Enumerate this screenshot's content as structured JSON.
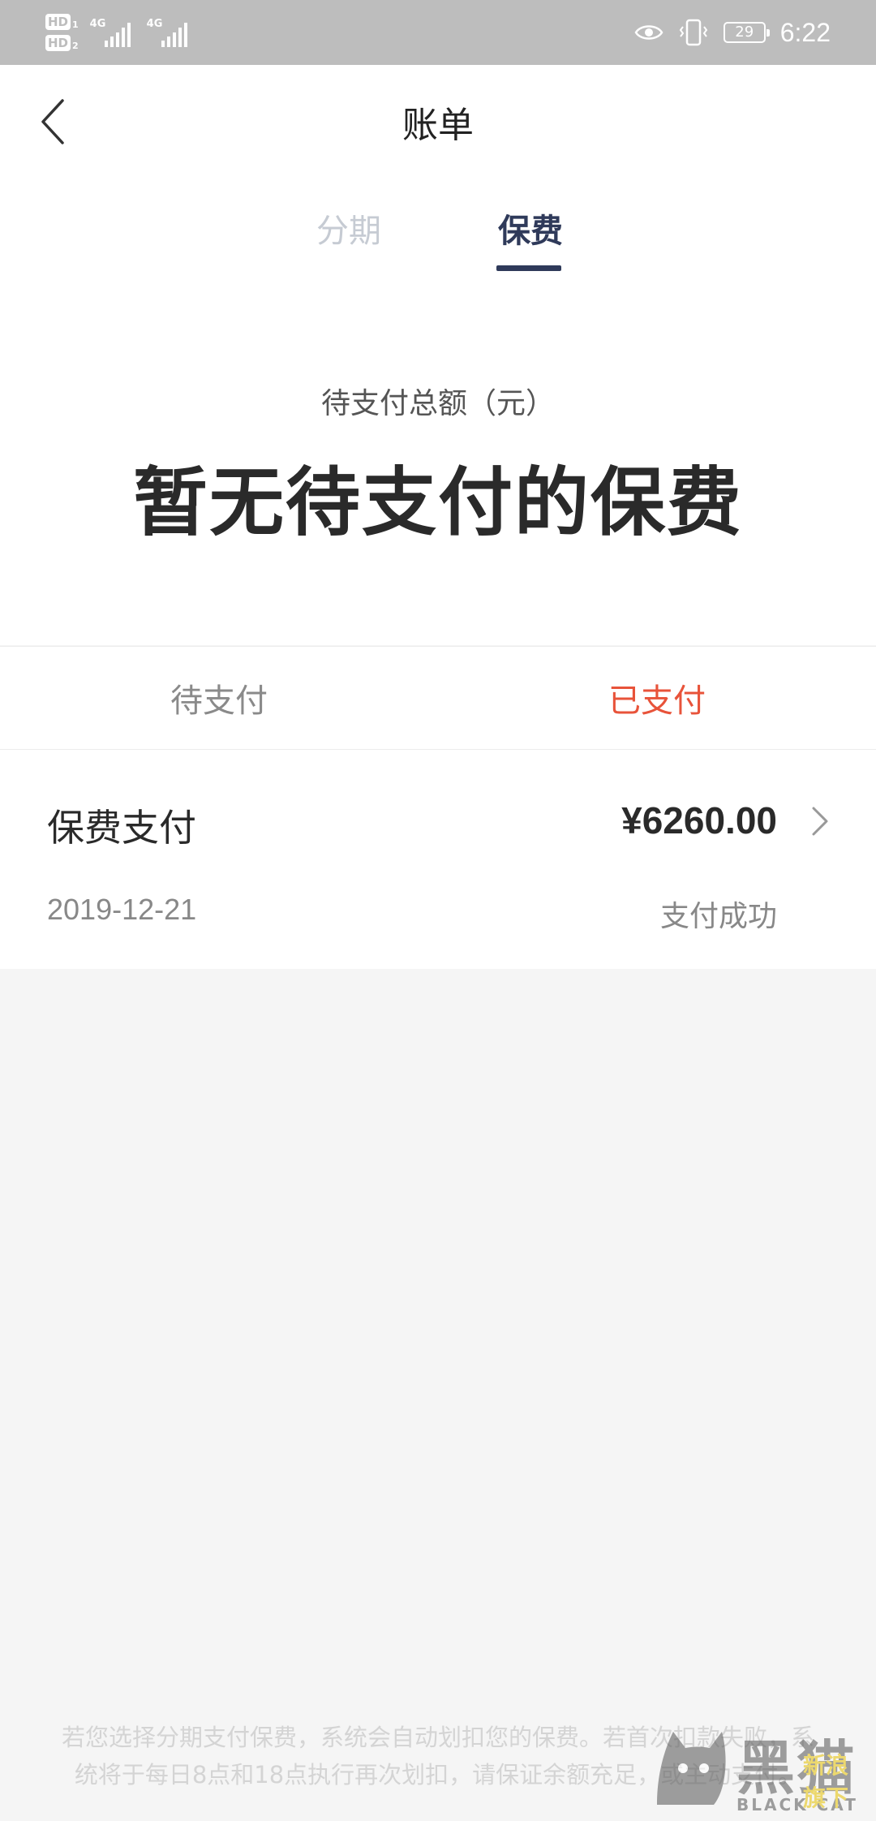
{
  "status_bar": {
    "sim1": "HD",
    "sim1_index": "1",
    "sim2": "HD",
    "sim2_index": "2",
    "network1": "4G",
    "network2": "4G",
    "battery": "29",
    "time": "6:22",
    "icons": [
      "eye-icon",
      "vibrate-icon",
      "battery-icon"
    ]
  },
  "header": {
    "title": "账单",
    "back_icon": "chevron-left-icon"
  },
  "tabs": [
    {
      "label": "分期",
      "active": false
    },
    {
      "label": "保费",
      "active": true
    }
  ],
  "summary": {
    "label": "待支付总额（元）",
    "value": "暂无待支付的保费"
  },
  "sub_tabs": [
    {
      "label": "待支付",
      "active": false
    },
    {
      "label": "已支付",
      "active": true
    }
  ],
  "records": [
    {
      "title": "保费支付",
      "amount": "¥6260.00",
      "date": "2019-12-21",
      "status": "支付成功",
      "icon": "chevron-right-icon"
    }
  ],
  "footer_note": {
    "line1": "若您选择分期支付保费，系统会自动划扣您的保费。若首次扣款失败，系",
    "line2": "统将于每日8点和18点执行再次划扣，请保证余额充足，或主动支付。"
  },
  "watermark": {
    "text": "黑猫",
    "text_en": "BLACK CAT",
    "sub": "新浪旗下"
  },
  "colors": {
    "accent_dark": "#2f3a5a",
    "accent_red": "#e8533a",
    "status_bar": "#bdbdbd",
    "background": "#f5f5f5"
  }
}
